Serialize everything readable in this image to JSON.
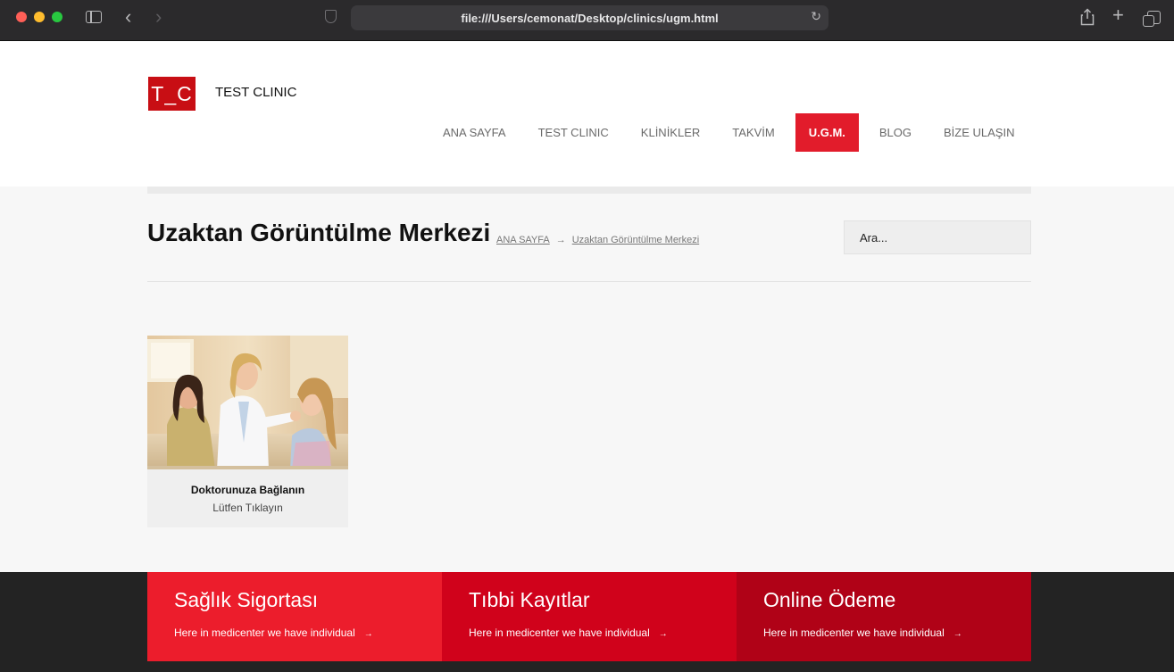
{
  "browser": {
    "url": "file:///Users/cemonat/Desktop/clinics/ugm.html"
  },
  "site": {
    "logo": "T_C",
    "name": "TEST CLINIC"
  },
  "nav": {
    "items": [
      {
        "label": "ANA SAYFA"
      },
      {
        "label": "TEST CLINIC"
      },
      {
        "label": "KLİNİKLER"
      },
      {
        "label": "TAKVİM"
      },
      {
        "label": "U.G.M.",
        "active": true
      },
      {
        "label": "BLOG"
      },
      {
        "label": "BİZE ULAŞIN"
      }
    ]
  },
  "page": {
    "title": "Uzaktan Görüntülme Merkezi",
    "breadcrumb": {
      "home": "ANA SAYFA",
      "separator": "→",
      "current": "Uzaktan Görüntülme Merkezi"
    },
    "search_placeholder": "Ara..."
  },
  "card": {
    "title": "Doktorunuza Bağlanın",
    "subtitle": "Lütfen Tıklayın"
  },
  "footer": {
    "boxes": [
      {
        "title": "Sağlık Sigortası",
        "text": "Here in medicenter we have individual",
        "arrow": "→"
      },
      {
        "title": "Tıbbi Kayıtlar",
        "text": "Here in medicenter we have individual",
        "arrow": "→"
      },
      {
        "title": "Online Ödeme",
        "text": "Here in medicenter we have individual",
        "arrow": "→"
      }
    ]
  },
  "colors": {
    "accent": "#e21c2b",
    "footer_box_1": "#ec1d2c",
    "footer_box_2": "#d0021b",
    "footer_box_3": "#b00217"
  }
}
